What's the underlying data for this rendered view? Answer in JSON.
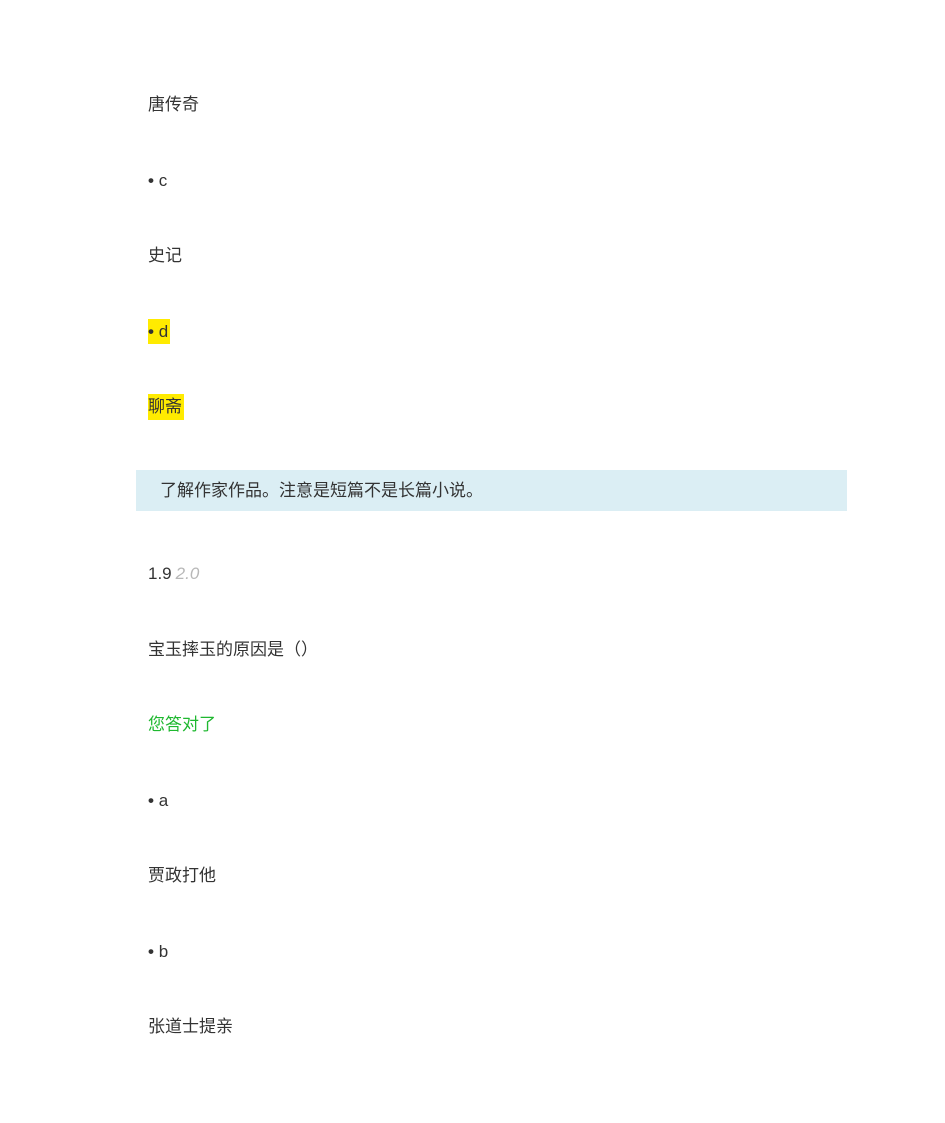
{
  "q1": {
    "option_b_text": "唐传奇",
    "option_c_letter": "c",
    "option_c_text": "史记",
    "option_d_letter": "d",
    "option_d_text": "聊斋",
    "explanation": "了解作家作品。注意是短篇不是长篇小说。"
  },
  "q2": {
    "number": "1.9",
    "total": "2.0",
    "stem": "宝玉摔玉的原因是（）",
    "result": "您答对了",
    "option_a_letter": "a",
    "option_a_text": "贾政打他",
    "option_b_letter": "b",
    "option_b_text": "张道士提亲"
  }
}
